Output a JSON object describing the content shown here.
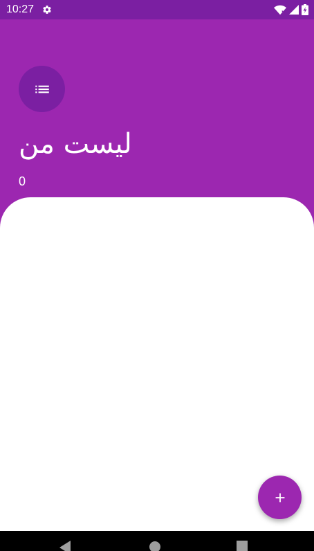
{
  "status_bar": {
    "time": "10:27",
    "icons": [
      "settings-gear-icon",
      "wifi-icon",
      "signal-icon",
      "battery-icon"
    ],
    "color": "#7b1fa2"
  },
  "header": {
    "list_icon": "list-icon",
    "title": "لیست من",
    "count": "0",
    "color": "#9c27b0"
  },
  "fab": {
    "icon": "add-icon",
    "color": "#9c27b0"
  },
  "nav_bar": {
    "buttons": [
      "back-icon",
      "home-icon",
      "recents-icon"
    ]
  }
}
